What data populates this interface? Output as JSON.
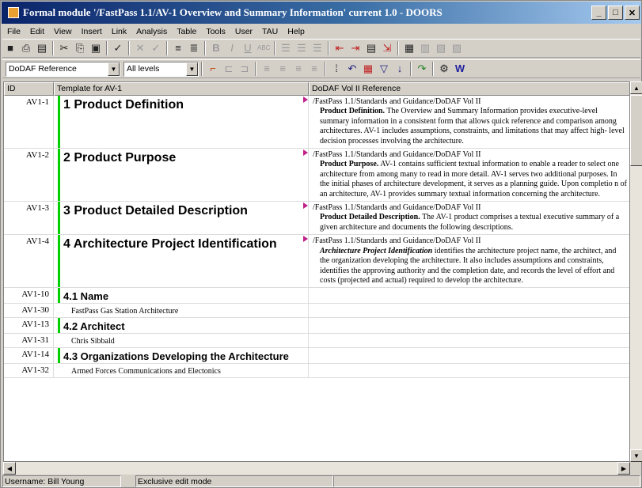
{
  "window": {
    "title": "Formal module '/FastPass 1.1/AV-1 Overview and Summary Information' current 1.0 - DOORS"
  },
  "menu": [
    "File",
    "Edit",
    "View",
    "Insert",
    "Link",
    "Analysis",
    "Table",
    "Tools",
    "User",
    "TAU",
    "Help"
  ],
  "toolbar2": {
    "view_select": "DoDAF Reference",
    "level_select": "All levels"
  },
  "columns": {
    "id": "ID",
    "main": "Template for AV-1",
    "ref": "DoDAF Vol II Reference"
  },
  "rows": [
    {
      "id": "AV1-1",
      "text": "1 Product Definition",
      "style": "h1",
      "ref_path": "/FastPass 1.1/Standards and Guidance/DoDAF Vol II",
      "ref_title": "Product Definition.",
      "ref_text": "The Overview and Summary Information provides executive-level summary information in a consistent form that allows quick reference and comparison among architectures. AV-1 includes assumptions, constraints, and limitations that may affect high- level decision processes involving the architecture."
    },
    {
      "id": "AV1-2",
      "text": "2 Product Purpose",
      "style": "h1",
      "ref_path": "/FastPass 1.1/Standards and Guidance/DoDAF Vol II",
      "ref_title": "Product Purpose.",
      "ref_text": "AV-1 contains sufficient textual information to enable a reader to select one architecture from among many to read in more detail. AV-1 serves two additional purposes. In the initial phases of architecture development, it serves as a planning guide. Upon completio n of an architecture, AV-1 provides summary textual information concerning the architecture."
    },
    {
      "id": "AV1-3",
      "text": "3 Product Detailed Description",
      "style": "h1",
      "ref_path": "/FastPass 1.1/Standards and Guidance/DoDAF Vol II",
      "ref_title": "Product Detailed Description.",
      "ref_text": "The AV-1 product comprises a textual executive summary of a given architecture and documents the following descriptions."
    },
    {
      "id": "AV1-4",
      "text": "4 Architecture Project Identification",
      "style": "h1",
      "ref_path": "/FastPass 1.1/Standards and Guidance/DoDAF Vol II",
      "ref_title": "Architecture Project Identification",
      "ref_text": "identifies the architecture project name, the architect, and the organization developing the architecture. It also includes assumptions and constraints, identifies the approving authority and the completion date, and records the level of effort and costs (projected and actual) required to develop the architecture."
    },
    {
      "id": "AV1-10",
      "text": "4.1 Name",
      "style": "h2"
    },
    {
      "id": "AV1-30",
      "text": "FastPass Gas Station Architecture",
      "style": "body"
    },
    {
      "id": "AV1-13",
      "text": "4.2 Architect",
      "style": "h2"
    },
    {
      "id": "AV1-31",
      "text": "Chris Sibbald",
      "style": "body"
    },
    {
      "id": "AV1-14",
      "text": "4.3 Organizations Developing the Architecture",
      "style": "h2"
    },
    {
      "id": "AV1-32",
      "text": "Armed Forces Communications and Electonics",
      "style": "body"
    }
  ],
  "status": {
    "user": "Username: Bill Young",
    "mode": "Exclusive edit mode"
  },
  "colors": {
    "title_start": "#0a246a",
    "title_end": "#a6caf0",
    "level_bar": "#00d000",
    "link_flag": "#c0208a"
  }
}
